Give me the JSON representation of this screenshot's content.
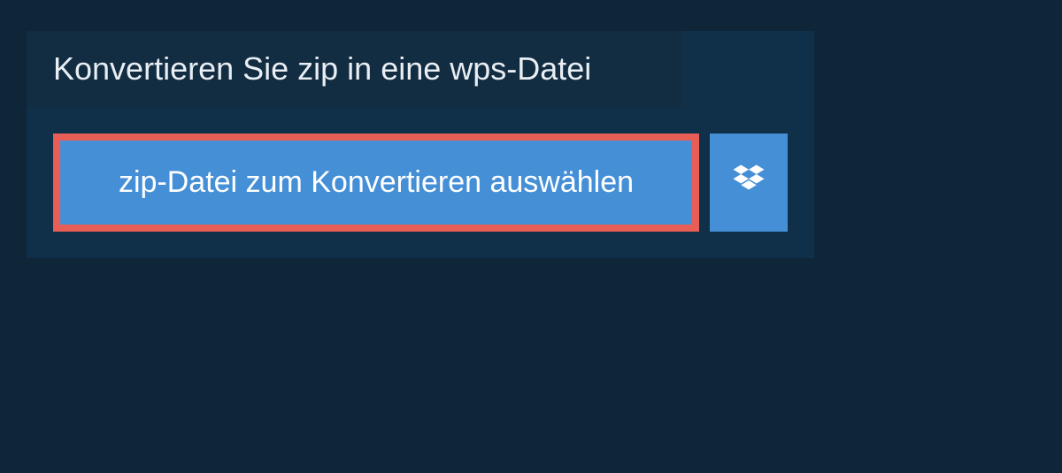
{
  "header": {
    "title": "Konvertieren Sie zip in eine wps-Datei"
  },
  "actions": {
    "select_file_label": "zip-Datei zum Konvertieren auswählen",
    "dropbox_icon": "dropbox"
  },
  "colors": {
    "panel_bg": "#10304a",
    "page_bg": "#0f2538",
    "button_bg": "#458fd6",
    "highlight_border": "#e85d55"
  }
}
